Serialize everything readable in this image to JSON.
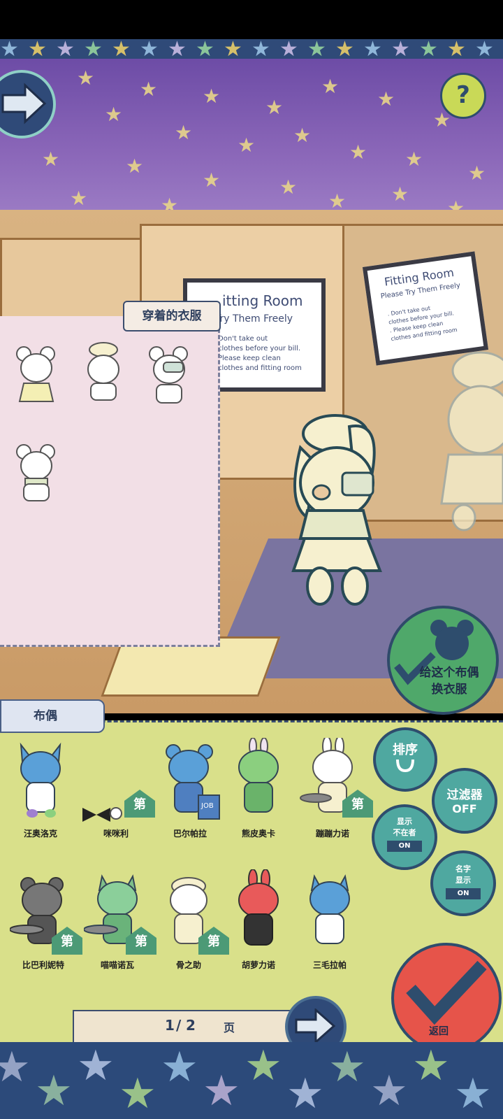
{
  "wear_panel": {
    "title": "穿着的衣服"
  },
  "signs": {
    "left": {
      "title": "itting Room",
      "subtitle": "Try Them Freely",
      "lines": [
        "Don't take out",
        "clothes before your bill.",
        "Please keep clean",
        "clothes and fitting room"
      ]
    },
    "right": {
      "title": "Fitting Room",
      "subtitle": "Please Try Them Freely",
      "lines": [
        ". Don't take out",
        "clothes before your bill.",
        ". Please keep clean",
        "clothes and fitting room"
      ]
    }
  },
  "change_clothes_button": {
    "label_line1": "给这个布偶",
    "label_line2": "换衣服"
  },
  "dolls_panel": {
    "title": "布偶",
    "items": [
      {
        "name": "汪奥洛克",
        "house": ""
      },
      {
        "name": "咪咪利",
        "house": "第"
      },
      {
        "name": "巴尔帕拉",
        "house": ""
      },
      {
        "name": "熊皮奥卡",
        "house": ""
      },
      {
        "name": "蹦蹦力诺",
        "house": "第"
      },
      {
        "name": "比巴利妮特",
        "house": "第"
      },
      {
        "name": "喵喵诺瓦",
        "house": "第"
      },
      {
        "name": "骨之助",
        "house": "第"
      },
      {
        "name": "胡萝力诺",
        "house": ""
      },
      {
        "name": "三毛拉帕",
        "house": ""
      }
    ]
  },
  "side_buttons": {
    "sort": "排序",
    "filter_line1": "过滤器",
    "filter_line2": "OFF",
    "show_absent_line1": "显示",
    "show_absent_line2": "不在者",
    "show_absent_state": "ON",
    "name_display_line1": "名字",
    "name_display_line2": "显示",
    "name_display_state": "ON",
    "return": "返回"
  },
  "pager": {
    "current": "1",
    "separator": "/",
    "total": "2",
    "unit": "页"
  },
  "colors": {
    "ceiling": "#7a58ad",
    "panel_pink": "#f2dfe6",
    "dolls_bg": "#d9e08a",
    "return_red": "#e6544a",
    "house_green": "#4c9a76",
    "border_navy": "#2e4d6d"
  }
}
